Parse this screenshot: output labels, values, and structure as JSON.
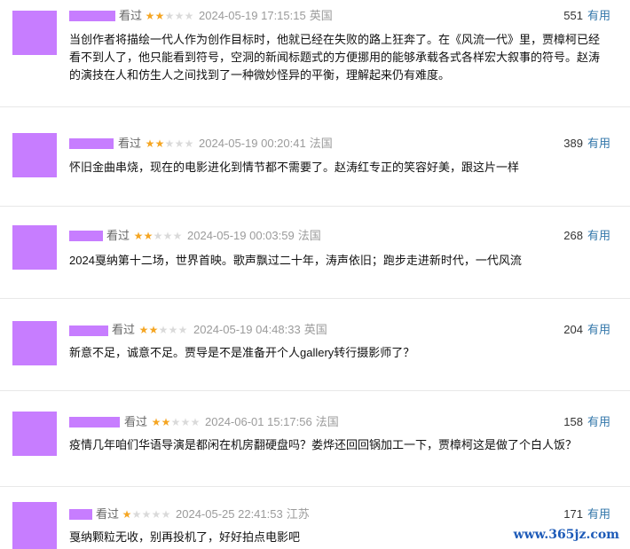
{
  "comments": [
    {
      "seen": "看过",
      "stars": 2,
      "time": "2024-05-19 17:15:15",
      "location": "英国",
      "votes": "551",
      "vote_label": "有用",
      "text": "当创作者将描绘一代人作为创作目标时，他就已经在失败的路上狂奔了。在《风流一代》里，贾樟柯已经看不到人了，他只能看到符号，空洞的新闻标题式的方便挪用的能够承载各式各样宏大叙事的符号。赵涛的演技在人和仿生人之间找到了一种微妙怪异的平衡，理解起来仍有难度。"
    },
    {
      "seen": "看过",
      "stars": 2,
      "time": "2024-05-19 00:20:41",
      "location": "法国",
      "votes": "389",
      "vote_label": "有用",
      "text": "怀旧金曲串烧，现在的电影进化到情节都不需要了。赵涛红专正的笑容好美，跟这片一样"
    },
    {
      "seen": "看过",
      "stars": 2,
      "time": "2024-05-19 00:03:59",
      "location": "法国",
      "votes": "268",
      "vote_label": "有用",
      "text": "2024戛纳第十二场，世界首映。歌声飘过二十年，涛声依旧；跑步走进新时代，一代风流"
    },
    {
      "seen": "看过",
      "stars": 2,
      "time": "2024-05-19 04:48:33",
      "location": "英国",
      "votes": "204",
      "vote_label": "有用",
      "text": "新意不足，诚意不足。贾导是不是准备开个人gallery转行摄影师了？"
    },
    {
      "seen": "看过",
      "stars": 2,
      "time": "2024-06-01 15:17:56",
      "location": "法国",
      "votes": "158",
      "vote_label": "有用",
      "text": "疫情几年咱们华语导演是都闲在机房翻硬盘吗？娄烨还回回锅加工一下，贾樟柯这是做了个白人饭？"
    },
    {
      "seen": "看过",
      "stars": 1,
      "time": "2024-05-25 22:41:53",
      "location": "江苏",
      "votes": "171",
      "vote_label": "有用",
      "text": "戛纳颗粒无收，别再投机了，好好拍点电影吧"
    }
  ],
  "watermark": "www.365jz.com",
  "colors": {
    "avatar_placeholder": "#c77dff",
    "star_on": "#f5a623",
    "star_off": "#dadada",
    "link": "#3377aa"
  }
}
